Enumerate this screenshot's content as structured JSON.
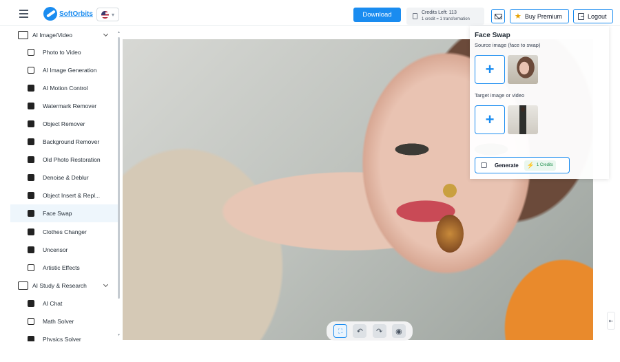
{
  "header": {
    "brand": "SoftOrbits",
    "language_flag": "us-flag",
    "download_label": "Download",
    "credits_main": "Credits Left:  113",
    "credits_sub": "1 credit = 1 transformation",
    "buy_premium_label": "Buy Premium",
    "logout_label": "Logout"
  },
  "sidebar": {
    "groups": [
      {
        "label": "AI Image/Video",
        "icon": "image-icon",
        "items": [
          {
            "label": "Photo to Video",
            "icon": "video-icon"
          },
          {
            "label": "AI Image Generation",
            "icon": "image-generation-icon"
          },
          {
            "label": "AI Motion Control",
            "icon": "motion-icon"
          },
          {
            "label": "Watermark Remover",
            "icon": "eraser-icon"
          },
          {
            "label": "Object Remover",
            "icon": "object-remove-icon"
          },
          {
            "label": "Background Remover",
            "icon": "background-remove-icon"
          },
          {
            "label": "Old Photo Restoration",
            "icon": "restoration-icon"
          },
          {
            "label": "Denoise & Deblur",
            "icon": "denoise-icon"
          },
          {
            "label": "Object Insert & Repl...",
            "icon": "object-insert-icon"
          },
          {
            "label": "Face Swap",
            "icon": "face-swap-icon",
            "active": true
          },
          {
            "label": "Clothes Changer",
            "icon": "clothes-icon"
          },
          {
            "label": "Uncensor",
            "icon": "uncensor-icon"
          },
          {
            "label": "Artistic Effects",
            "icon": "brush-icon"
          }
        ]
      },
      {
        "label": "AI Study & Research",
        "icon": "book-icon",
        "items": [
          {
            "label": "AI Chat",
            "icon": "chat-icon"
          },
          {
            "label": "Math Solver",
            "icon": "math-icon"
          },
          {
            "label": "Physics Solver",
            "icon": "physics-icon"
          }
        ]
      }
    ]
  },
  "toolbar": {
    "fit_icon": "fit-screen-icon",
    "undo_icon": "undo-icon",
    "redo_icon": "redo-icon",
    "preview_icon": "eye-icon"
  },
  "panel": {
    "title": "Face Swap",
    "source_label": "Source image (face to swap)",
    "target_label": "Target image or video",
    "generate_label": "Generate",
    "generate_credits": "1 Credits"
  },
  "colors": {
    "accent": "#1a8cf0",
    "active_item_bg": "#eef6fc",
    "credits_green": "#22a35a"
  }
}
